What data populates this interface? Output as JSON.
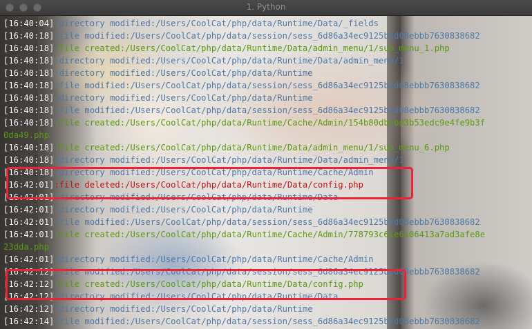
{
  "window": {
    "title": "1. Python",
    "buttons": [
      "close",
      "minimize",
      "zoom"
    ],
    "highlight_color": "#ee2236"
  },
  "log": {
    "lines": [
      {
        "ts": "[16:40:04]",
        "sep": ":",
        "text": "directory modified:/Users/CoolCat/php/data/Runtime/Data/_fields",
        "kind": "dir"
      },
      {
        "ts": "[16:40:18]",
        "sep": ":",
        "text": "file modified:/Users/CoolCat/php/data/session/sess_6d86a34ec9125b2d08ebbb7630838682",
        "kind": "mod"
      },
      {
        "ts": "[16:40:18]",
        "sep": ":",
        "text": "file created:/Users/CoolCat/php/data/Runtime/Data/admin_menu/1/sub_menu_1.php",
        "kind": "cre"
      },
      {
        "ts": "[16:40:18]",
        "sep": ":",
        "text": "directory modified:/Users/CoolCat/php/data/Runtime/Data/admin_menu/1",
        "kind": "dir"
      },
      {
        "ts": "[16:40:18]",
        "sep": ":",
        "text": "directory modified:/Users/CoolCat/php/data/Runtime",
        "kind": "dir"
      },
      {
        "ts": "[16:40:18]",
        "sep": ":",
        "text": "file modified:/Users/CoolCat/php/data/session/sess_6d86a34ec9125b2d08ebbb7630838682",
        "kind": "mod"
      },
      {
        "ts": "[16:40:18]",
        "sep": ":",
        "text": "directory modified:/Users/CoolCat/php/data/Runtime",
        "kind": "dir"
      },
      {
        "ts": "[16:40:18]",
        "sep": ":",
        "text": "file modified:/Users/CoolCat/php/data/session/sess_6d86a34ec9125b2d08ebbb7630838682",
        "kind": "mod"
      },
      {
        "ts": "[16:40:18]",
        "sep": ":",
        "text": "file created:/Users/CoolCat/php/data/Runtime/Cache/Admin/154b80dbcbd3b53edc9e4fe9b3f",
        "kind": "cre"
      },
      {
        "ts": "",
        "sep": "",
        "text": "0da49.php",
        "kind": "cre"
      },
      {
        "ts": "[16:40:18]",
        "sep": ":",
        "text": "file created:/Users/CoolCat/php/data/Runtime/Data/admin_menu/1/sub_menu_6.php",
        "kind": "cre"
      },
      {
        "ts": "[16:40:18]",
        "sep": ":",
        "text": "directory modified:/Users/CoolCat/php/data/Runtime/Data/admin_menu/1",
        "kind": "dir"
      },
      {
        "ts": "[16:40:18]",
        "sep": ":",
        "text": "directory modified:/Users/CoolCat/php/data/Runtime/Cache/Admin",
        "kind": "dir"
      },
      {
        "ts": "[16:42:01]",
        "sep": ":",
        "text": "file deleted:/Users/CoolCat/php/data/Runtime/Data/config.php",
        "kind": "del"
      },
      {
        "ts": "[16:42:01]",
        "sep": ":",
        "text": "directory modified:/Users/CoolCat/php/data/Runtime/Data",
        "kind": "dir"
      },
      {
        "ts": "[16:42:01]",
        "sep": ":",
        "text": "directory modified:/Users/CoolCat/php/data/Runtime",
        "kind": "dir"
      },
      {
        "ts": "[16:42:01]",
        "sep": ":",
        "text": "file modified:/Users/CoolCat/php/data/session/sess_6d86a34ec9125b2d08ebbb7630838682",
        "kind": "mod"
      },
      {
        "ts": "[16:42:01]",
        "sep": ":",
        "text": "file created:/Users/CoolCat/php/data/Runtime/Cache/Admin/778793c61e6106413a7ad3afe8e",
        "kind": "cre"
      },
      {
        "ts": "",
        "sep": "",
        "text": "23dda.php",
        "kind": "cre"
      },
      {
        "ts": "[16:42:01]",
        "sep": ":",
        "text": "directory modified:/Users/CoolCat/php/data/Runtime/Cache/Admin",
        "kind": "dir"
      },
      {
        "ts": "[16:42:12]",
        "sep": ":",
        "text": "file modified:/Users/CoolCat/php/data/session/sess_6d86a34ec9125b2d08ebbb7630838682",
        "kind": "mod"
      },
      {
        "ts": "[16:42:12]",
        "sep": ":",
        "text": "file created:/Users/CoolCat/php/data/Runtime/Data/config.php",
        "kind": "cre"
      },
      {
        "ts": "[16:42:12]",
        "sep": ":",
        "text": "directory modified:/Users/CoolCat/php/data/Runtime/Data",
        "kind": "dir"
      },
      {
        "ts": "[16:42:12]",
        "sep": ":",
        "text": "directory modified:/Users/CoolCat/php/data/Runtime",
        "kind": "dir"
      },
      {
        "ts": "[16:42:14]",
        "sep": ":",
        "text": "file modified:/Users/CoolCat/php/data/session/sess_6d86a34ec9125b2d08ebbb7630838682",
        "kind": "mod"
      }
    ],
    "colors": {
      "timestamp": "#ffffff",
      "directory": "#4d78a6",
      "modified": "#4d78a6",
      "created": "#5a9a10",
      "deleted": "#c01414"
    }
  }
}
